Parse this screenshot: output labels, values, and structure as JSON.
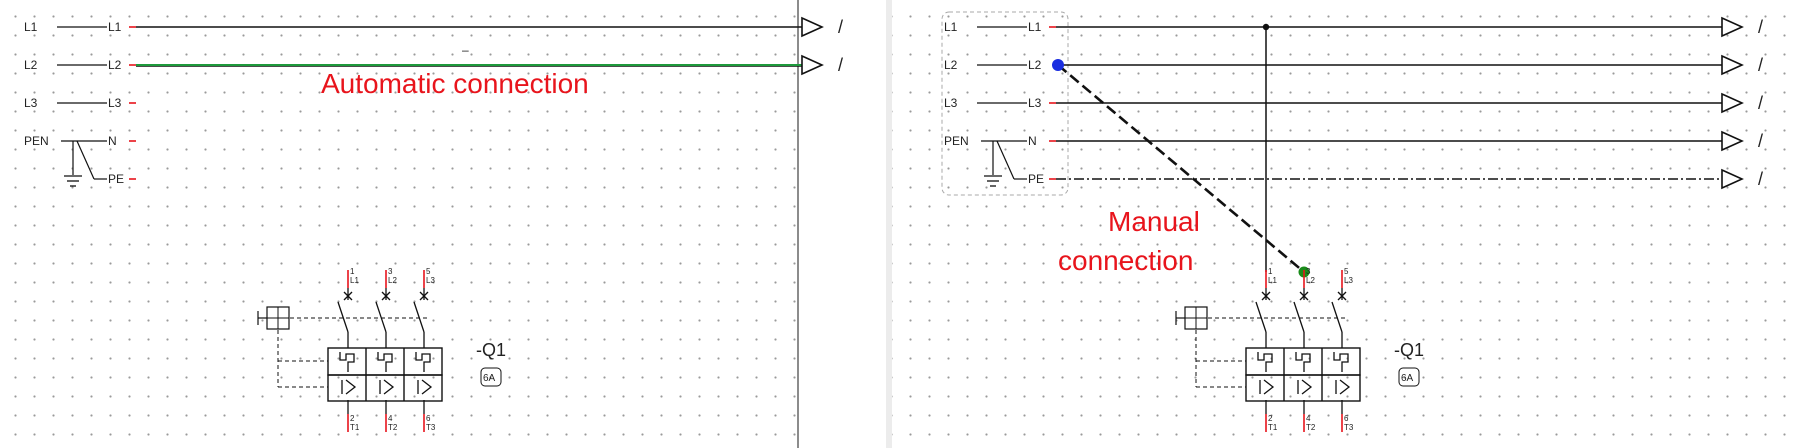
{
  "colors": {
    "annotation": "#e8141c",
    "auto_line": "#1e9a3c",
    "blue_node": "#1a2ee0",
    "green_node": "#1a8c1a",
    "divider": "#8c8c8c"
  },
  "left": {
    "sources": [
      "L1",
      "L2",
      "L3",
      "PEN"
    ],
    "targets": [
      "L1",
      "L2",
      "L3",
      "N",
      "PE"
    ],
    "annotation": "Automatic connection",
    "dash_mark": "–",
    "arrow_marks": [
      "/",
      "/"
    ],
    "breaker": {
      "name": "-Q1",
      "rating": "6A",
      "top_numbers": [
        "1",
        "3",
        "5"
      ],
      "top_labels": [
        "L1",
        "L2",
        "L3"
      ],
      "bottom_numbers": [
        "2",
        "4",
        "6"
      ],
      "bottom_labels": [
        "T1",
        "T2",
        "T3"
      ]
    }
  },
  "right": {
    "sources": [
      "L1",
      "L2",
      "L3",
      "PEN"
    ],
    "targets": [
      "L1",
      "L2",
      "L3",
      "N",
      "PE"
    ],
    "annotation_line1": "Manual",
    "annotation_line2": "connection",
    "arrow_marks": [
      "/",
      "/",
      "/",
      "/",
      "/"
    ],
    "breaker": {
      "name": "-Q1",
      "rating": "6A",
      "top_numbers": [
        "1",
        "3",
        "5"
      ],
      "top_labels": [
        "L1",
        "L2",
        "L3"
      ],
      "bottom_numbers": [
        "2",
        "4",
        "6"
      ],
      "bottom_labels": [
        "T1",
        "T2",
        "T3"
      ]
    }
  }
}
